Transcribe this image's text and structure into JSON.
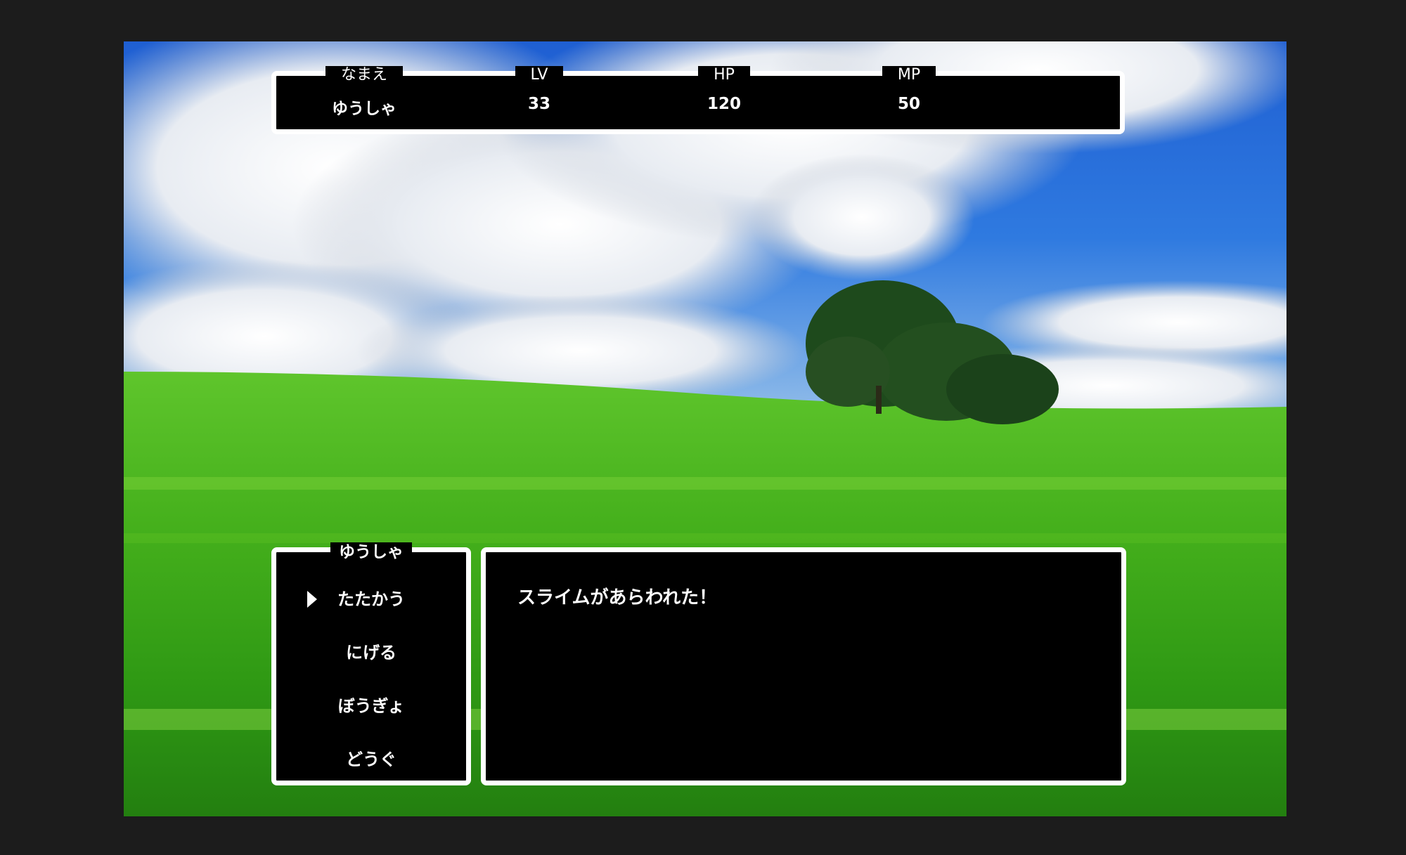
{
  "status": {
    "columns": [
      {
        "header": "なまえ",
        "value": "ゆうしゃ"
      },
      {
        "header": "LV",
        "value": "33"
      },
      {
        "header": "HP",
        "value": "120"
      },
      {
        "header": "MP",
        "value": "50"
      }
    ]
  },
  "command": {
    "title": "ゆうしゃ",
    "items": [
      "たたかう",
      "にげる",
      "ぼうぎょ",
      "どうぐ"
    ],
    "selected_index": 0
  },
  "message": {
    "text": "スライムがあらわれた！"
  },
  "colors": {
    "window_bg": "#000000",
    "window_border": "#ffffff",
    "frame_bg": "#1c1c1c"
  }
}
